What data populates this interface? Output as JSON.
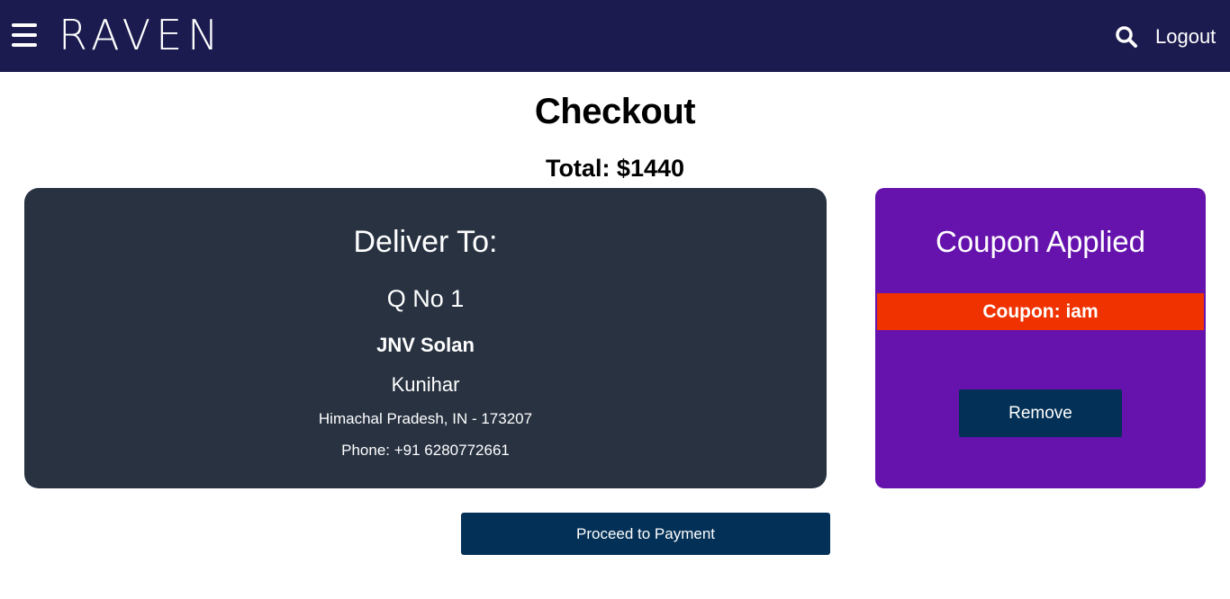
{
  "navbar": {
    "brand": "RAVEN",
    "logout_label": "Logout",
    "background_color": "#1b1b4f",
    "menu_icon": "hamburger-menu-icon",
    "search_icon": "search-icon"
  },
  "page": {
    "title": "Checkout",
    "total": "Total: $1440"
  },
  "delivery": {
    "heading": "Deliver To:",
    "address_line1": "Q No 1",
    "address_line2": "JNV Solan",
    "city": "Kunihar",
    "region": "Himachal Pradesh, IN - 173207",
    "phone": "Phone: +91 6280772661",
    "card_color": "#283241"
  },
  "coupon": {
    "heading": "Coupon Applied",
    "code_label": "Coupon: iam",
    "remove_label": "Remove",
    "card_color": "#6613ae",
    "code_bg_color": "#ef3200"
  },
  "actions": {
    "proceed_label": "Proceed to Payment",
    "button_color": "#033056"
  }
}
